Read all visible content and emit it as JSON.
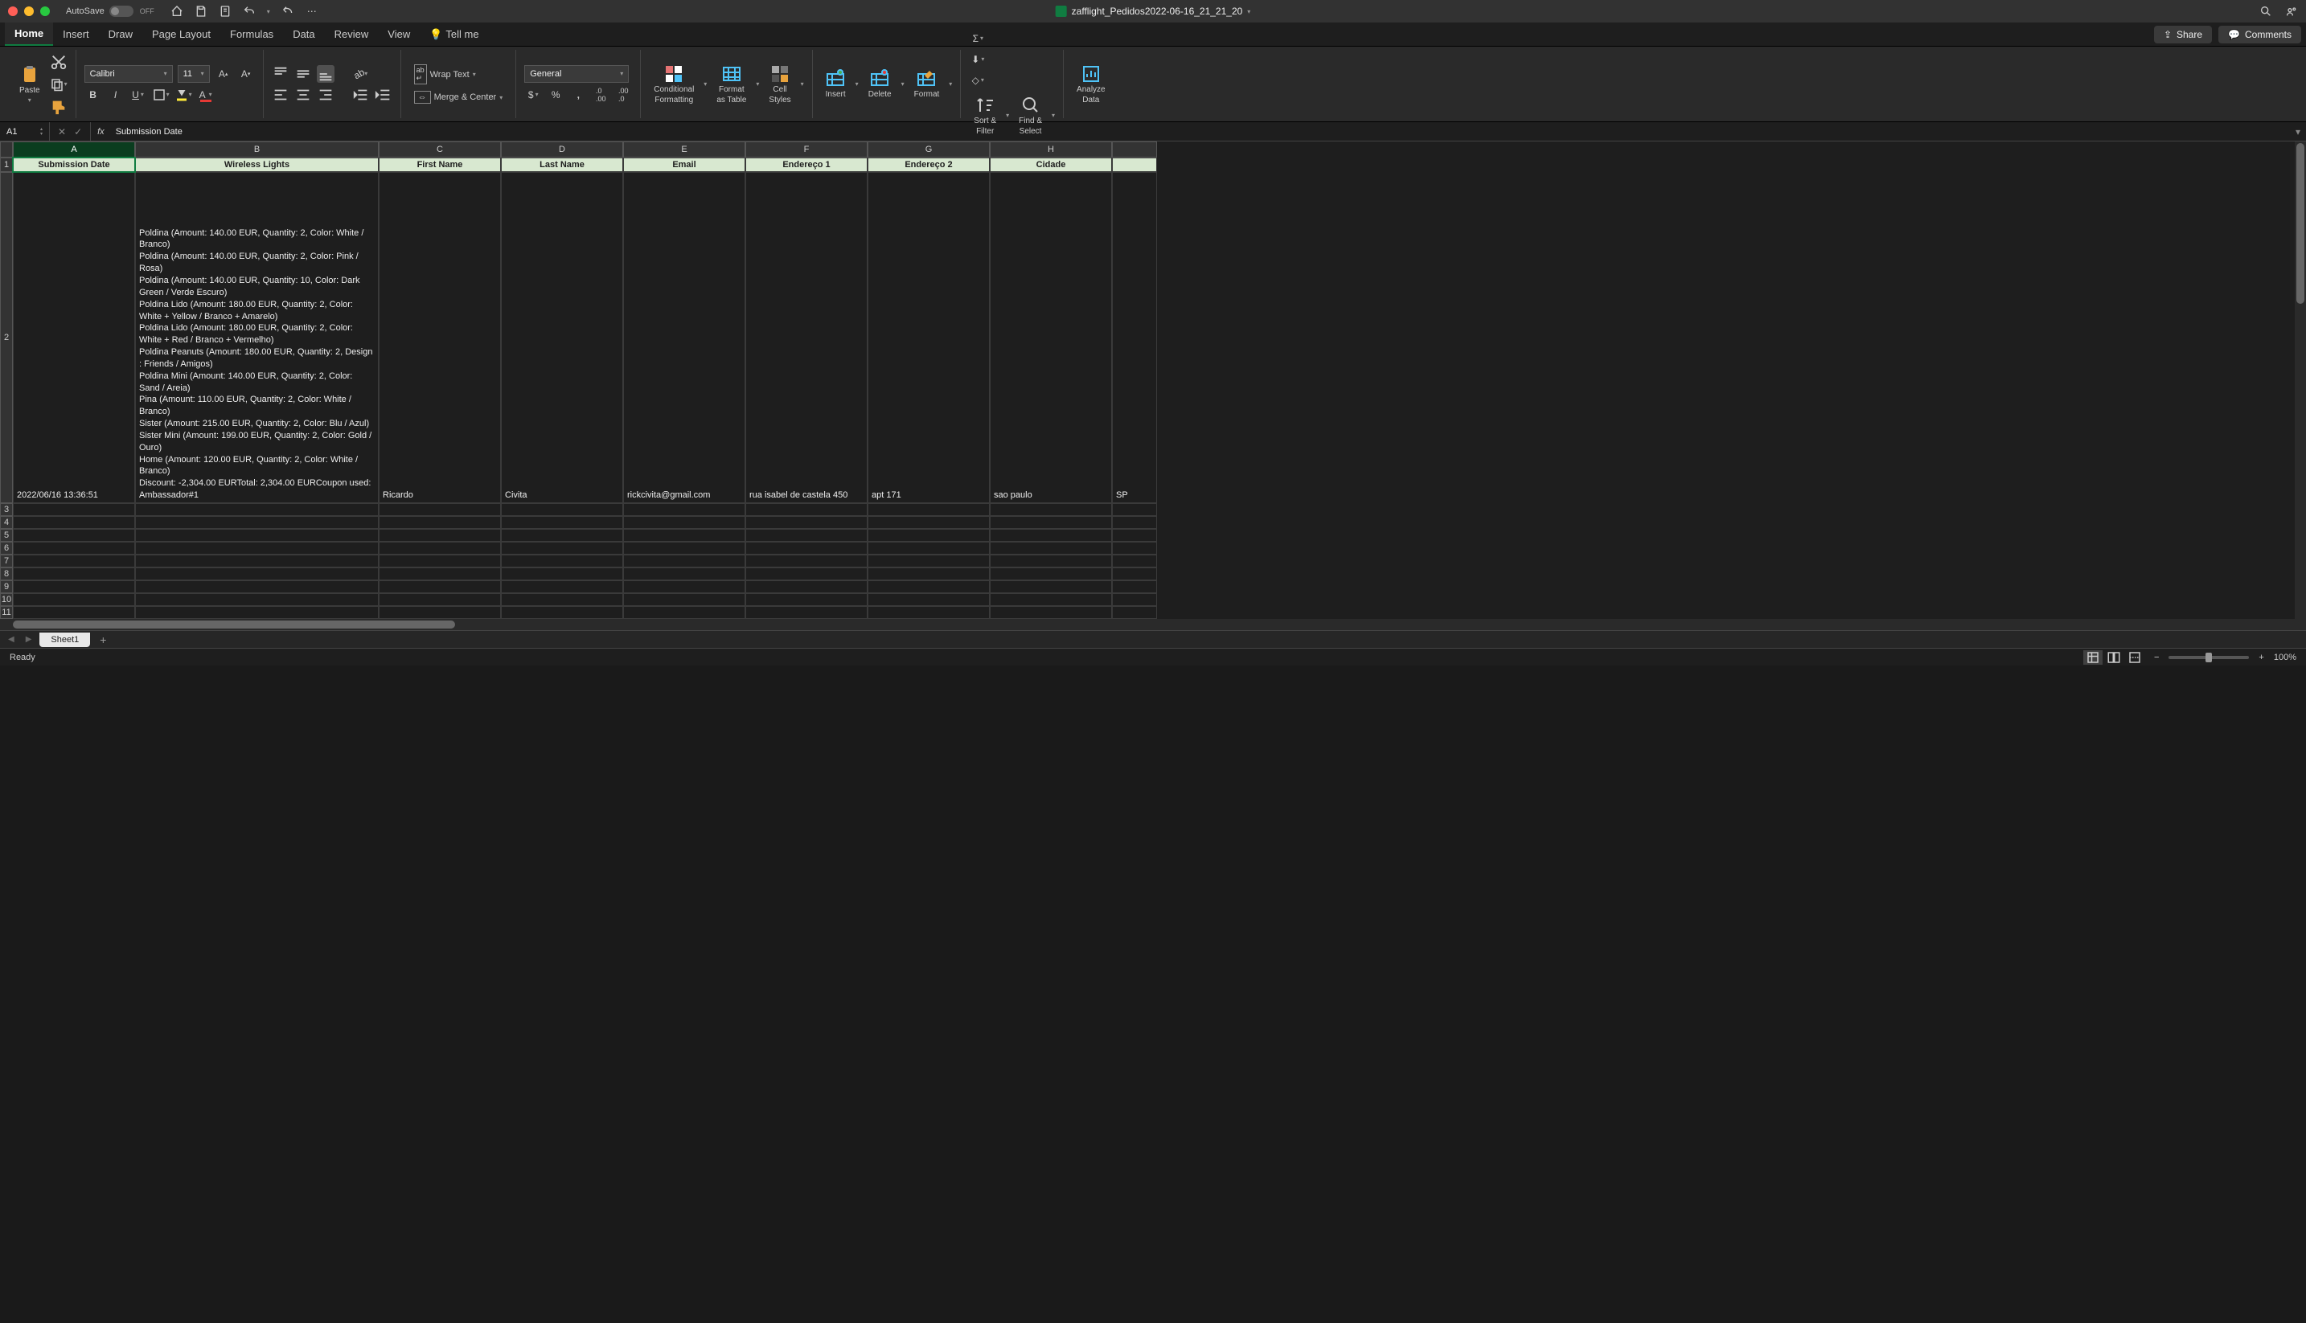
{
  "titlebar": {
    "autosave_label": "AutoSave",
    "autosave_state": "OFF",
    "filename": "zafflight_Pedidos2022-06-16_21_21_20"
  },
  "ribbon_tabs": [
    "Home",
    "Insert",
    "Draw",
    "Page Layout",
    "Formulas",
    "Data",
    "Review",
    "View"
  ],
  "tellme": "Tell me",
  "share": "Share",
  "comments": "Comments",
  "ribbon": {
    "paste": "Paste",
    "font_name": "Calibri",
    "font_size": "11",
    "wrap_text": "Wrap Text",
    "merge_center": "Merge & Center",
    "number_format": "General",
    "cond_fmt_l1": "Conditional",
    "cond_fmt_l2": "Formatting",
    "fmt_table_l1": "Format",
    "fmt_table_l2": "as Table",
    "cell_styles_l1": "Cell",
    "cell_styles_l2": "Styles",
    "insert": "Insert",
    "delete": "Delete",
    "format": "Format",
    "sort_l1": "Sort &",
    "sort_l2": "Filter",
    "find_l1": "Find &",
    "find_l2": "Select",
    "analyze_l1": "Analyze",
    "analyze_l2": "Data"
  },
  "formula_bar": {
    "name_box": "A1",
    "formula": "Submission Date"
  },
  "columns": [
    "A",
    "B",
    "C",
    "D",
    "E",
    "F",
    "G",
    "H"
  ],
  "rows": [
    "1",
    "2",
    "3",
    "4",
    "5",
    "6",
    "7",
    "8",
    "9",
    "10",
    "11"
  ],
  "headers": {
    "A": "Submission Date",
    "B": "Wireless Lights",
    "C": "First Name",
    "D": "Last Name",
    "E": "Email",
    "F": "Endereço 1",
    "G": "Endereço 2",
    "H": "Cidade"
  },
  "row2": {
    "A": "2022/06/16 13:36:51",
    "B": "Poldina (Amount: 140.00 EUR, Quantity: 2, Color: White / Branco)\nPoldina (Amount: 140.00 EUR, Quantity: 2, Color: Pink / Rosa)\nPoldina (Amount: 140.00 EUR, Quantity: 10, Color: Dark Green / Verde Escuro)\nPoldina Lido (Amount: 180.00 EUR, Quantity: 2, Color: White + Yellow / Branco + Amarelo)\nPoldina Lido (Amount: 180.00 EUR, Quantity: 2, Color: White + Red / Branco + Vermelho)\nPoldina Peanuts (Amount: 180.00 EUR, Quantity: 2, Design : Friends / Amigos)\nPoldina Mini (Amount: 140.00 EUR, Quantity: 2, Color: Sand / Areia)\nPina (Amount: 110.00 EUR, Quantity: 2, Color: White / Branco)\nSister (Amount: 215.00 EUR, Quantity: 2, Color: Blu / Azul)\nSister Mini (Amount: 199.00 EUR, Quantity: 2, Color: Gold / Ouro)\nHome (Amount: 120.00 EUR, Quantity: 2, Color: White / Branco)\nDiscount: -2,304.00 EURTotal: 2,304.00 EURCoupon used: Ambassador#1",
    "C": "Ricardo",
    "D": "Civita",
    "E": "rickcivita@gmail.com",
    "F": "rua isabel de castela 450",
    "G": "apt 171",
    "H": "sao paulo",
    "I": "SP"
  },
  "sheet_tabs": {
    "active": "Sheet1"
  },
  "status": {
    "ready": "Ready",
    "zoom": "100%",
    "plus": "+",
    "minus": "−"
  },
  "colors": {
    "accent": "#107c41",
    "header_bg": "#d8e8d0"
  }
}
